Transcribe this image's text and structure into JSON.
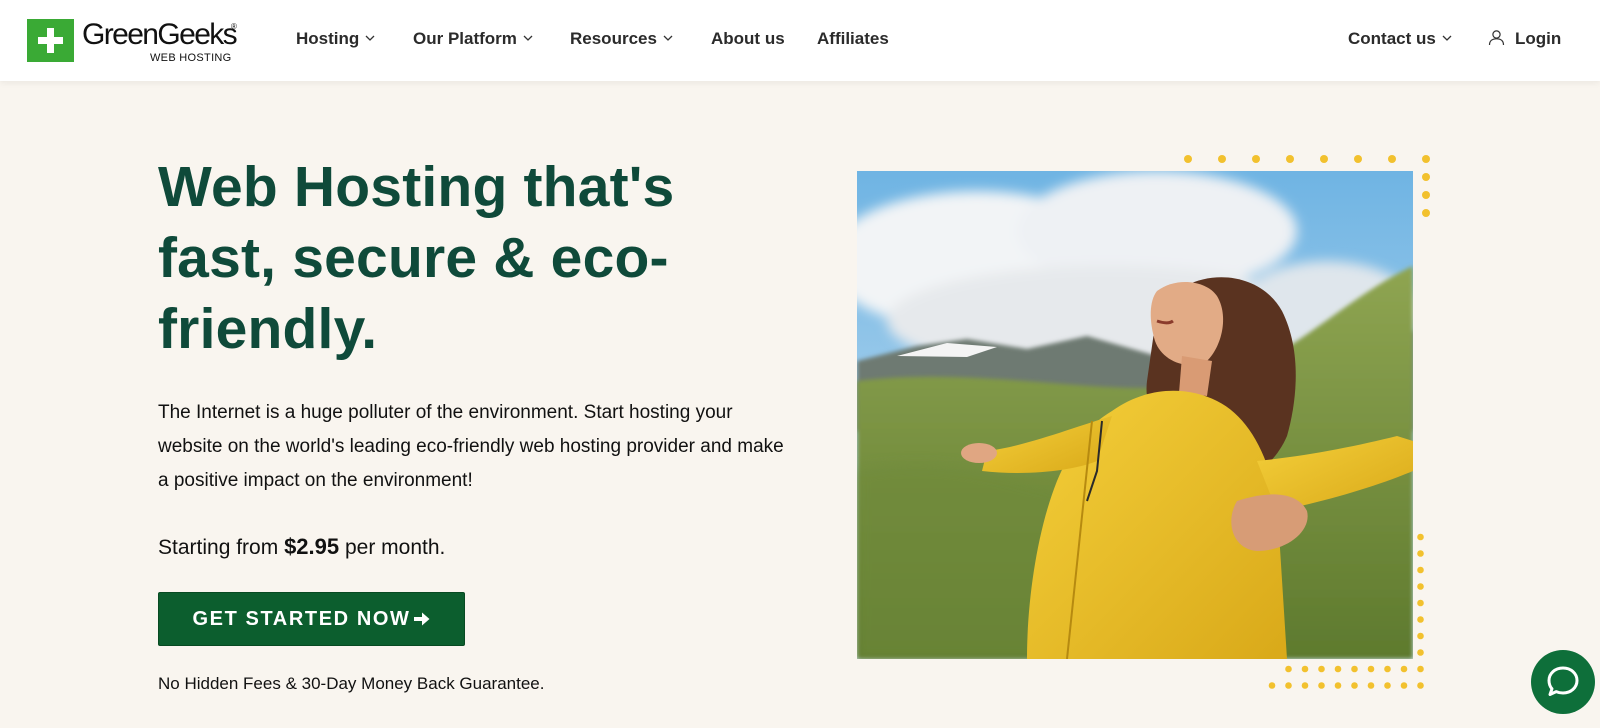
{
  "brand": {
    "name": "GreenGeeks",
    "registered": "®",
    "tagline": "WEB HOSTING",
    "color": "#3aaa35"
  },
  "nav": {
    "items": [
      {
        "label": "Hosting",
        "has_dropdown": true
      },
      {
        "label": "Our Platform",
        "has_dropdown": true
      },
      {
        "label": "Resources",
        "has_dropdown": true
      },
      {
        "label": "About us",
        "has_dropdown": false
      },
      {
        "label": "Affiliates",
        "has_dropdown": false
      }
    ],
    "contact": {
      "label": "Contact us",
      "has_dropdown": true
    },
    "login": {
      "label": "Login",
      "icon": "user-icon"
    }
  },
  "hero": {
    "title_lines": [
      "Web Hosting that's",
      "fast, secure & eco-",
      "friendly."
    ],
    "description": "The Internet is a huge polluter of the environment. Start hosting your website on the world's leading eco-friendly web hosting provider and make a positive impact on the environment!",
    "price_prefix": "Starting from",
    "price_value": "$2.95",
    "price_suffix": "per month.",
    "cta_label": "GET STARTED NOW",
    "cta_icon": "arrow-right-icon",
    "guarantee": "No Hidden Fees & 30-Day Money Back Guarantee.",
    "image_icon": "woman-in-yellow-jacket-photo"
  },
  "chat": {
    "icon": "chat-bubble-icon"
  },
  "colors": {
    "page_bg": "#f9f5ef",
    "heading": "#0f4a3a",
    "cta": "#0c5e2e",
    "dots": "#f2c12e",
    "chat": "#0e6f3a"
  }
}
